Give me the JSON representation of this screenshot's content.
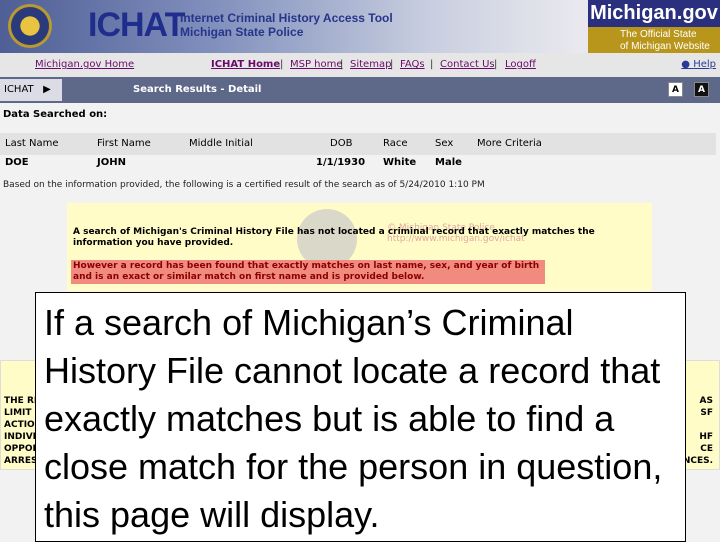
{
  "header": {
    "logo": "ICHAT",
    "subtitle_1": "Internet Criminal History Access Tool",
    "subtitle_2": "Michigan State Police",
    "mgov_title": "Michigan.gov",
    "mgov_tagline_1": "The Official State",
    "mgov_tagline_2": "of Michigan Website",
    "seal": "michigan-state-police-seal"
  },
  "nav": {
    "home": "Michigan.gov Home",
    "links": [
      "ICHAT Home",
      "MSP home",
      "Sitemap",
      "FAQs",
      "Contact Us",
      "Logoff"
    ],
    "help": "Help"
  },
  "bar": {
    "tab": "ICHAT",
    "title": "Search Results - Detail",
    "font_small": "A",
    "font_large": "A"
  },
  "search": {
    "label": "Data Searched on:",
    "columns": [
      "Last Name",
      "First Name",
      "Middle Initial",
      "DOB",
      "Race",
      "Sex",
      "More Criteria"
    ],
    "row": [
      "DOE",
      "JOHN",
      "",
      "1/1/1930",
      "White",
      "Male",
      ""
    ]
  },
  "certified": "Based on the information provided, the following is a certified result of the search as of 5/24/2010 1:10 PM",
  "notice": {
    "text": "A search of Michigan's Criminal History File has not located a criminal record that exactly matches the information you have provided.",
    "watermark_1": "© Michigan State Police",
    "watermark_2": "http://www.michigan.gov/ichat",
    "alert": "However a record has been found that exactly matches on last name, sex, and year of birth and is an exact or similar match on first name and is provided below."
  },
  "disclaimer": {
    "left": [
      "THE RE",
      "LIMIT",
      "ACTIO",
      "INDIVI",
      "OPPOR",
      "ARRES"
    ],
    "right": [
      "AS",
      "SF",
      "",
      "HF",
      "CE",
      "NCES."
    ]
  },
  "caption": "If a search of Michigan’s Criminal History File cannot locate a record that exactly matches but is able to find a close match for the person in question, this page will display."
}
